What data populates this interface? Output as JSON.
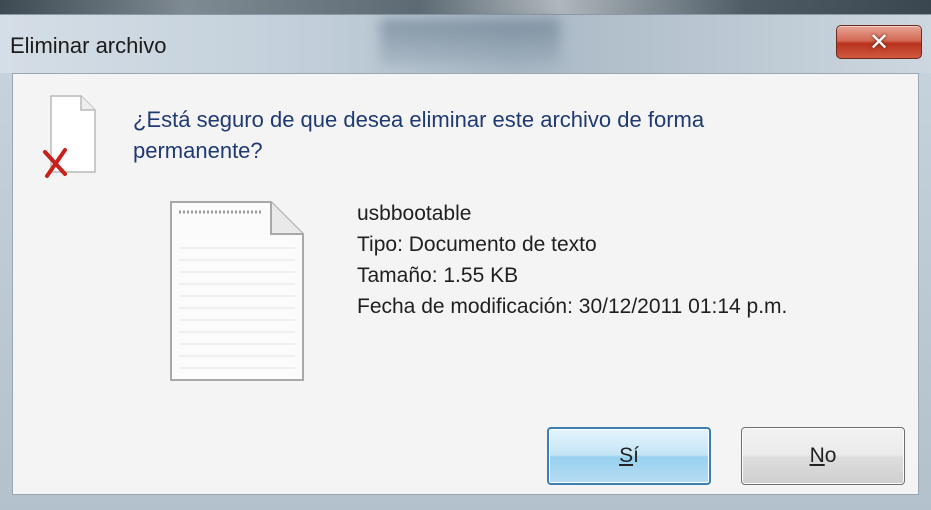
{
  "window": {
    "title": "Eliminar archivo",
    "close_icon": "close-icon"
  },
  "dialog": {
    "question": "¿Está seguro de que desea eliminar este archivo de forma permanente?",
    "icon": "delete-file-icon",
    "file": {
      "icon": "text-document-icon",
      "name": "usbbootable",
      "type": "Tipo: Documento de texto",
      "size": "Tamaño: 1.55 KB",
      "modified": "Fecha de modificación: 30/12/2011 01:14 p.m."
    },
    "buttons": {
      "yes_mnemonic": "S",
      "yes_rest": "í",
      "no_mnemonic": "N",
      "no_rest": "o"
    }
  },
  "colors": {
    "question_text": "#1f3a72",
    "close_button": "#c7462e",
    "default_button_border": "#3c7fb1"
  }
}
